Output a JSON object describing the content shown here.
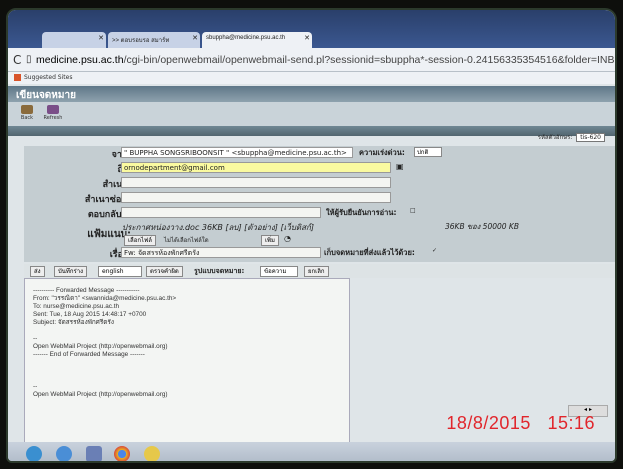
{
  "browser": {
    "tabs": [
      "",
      ">> ตอบรอบรอ สมาร์ท",
      "sbuppha@medicine.psu.ac.th"
    ],
    "url_host": "medicine.psu.ac.th",
    "url_path": "/cgi-bin/openwebmail/openwebmail-send.pl?sessionid=sbuppha*-session-0.24156335354516&folder=INBOX&page=1&longpage=0&sort=date_",
    "bookmark": "Suggested Sites"
  },
  "webmail": {
    "title": "เขียนจดหมาย",
    "toolbar": {
      "back": "Back",
      "refresh": "Refresh"
    },
    "charset_label": "รหัสตัวอักษร:",
    "charset_value": "tis-620",
    "from_label": "จาก:",
    "from_value": "\" BUPPHA SONGSRIBOONSIT \" <sbuppha@medicine.psu.ac.th>",
    "priority_label": "ความเร่งด่วน:",
    "priority_value": "ปกติ",
    "to_label": "ถึง:",
    "to_value": "ornodepartment@gmail.com",
    "cc_label": "สำเนา:",
    "bcc_label": "สำเนาซ่อน:",
    "reply_label": "ตอบกลับที่:",
    "receipt_label": "ให้ผู้รับยืนยันการอ่าน:",
    "attach_label": "แฟ้มแนบ:",
    "attach_file": "ประกาศหน่องวาง.doc  36KB  [ลบ] [ตัวอย่าง] [เว็บดิสก์]",
    "attach_size": "36KB ของ 50000 KB",
    "choose_file": "เลือกไฟล์",
    "no_file": "ไม่ได้เลือกไฟล์ใด",
    "add_btn": "เพิ่ม",
    "subject_label": "เรื่อง:",
    "subject_value": "Fw: จัดสรรห้องพักศรีตรัง",
    "save_sent_label": "เก็บจดหมายที่ส่งแล้วไว้ด้วย:",
    "editor_toolbar": {
      "send": "ส่ง",
      "save_draft": "บันทึกร่าง",
      "lang": "english",
      "spell": "ตรวจคำผิด",
      "format_label": "รูปแบบจดหมาย:",
      "format_value": "ข้อความ",
      "cancel": "ยกเลิก"
    },
    "body_lines": [
      "---------- Forwarded Message -----------",
      "From: \"วรรณิดา\" <swannida@medicine.psu.ac.th>",
      "To: nurse@medicine.psu.ac.th",
      "Sent: Tue, 18 Aug 2015 14:48:17 +0700",
      "Subject: จัดสรรห้องพักศรีตรัง",
      "",
      "--",
      "Open WebMail Project (http://openwebmail.org)",
      "------- End of Forwarded Message -------",
      "",
      "",
      "",
      "--",
      "Open WebMail Project (http://openwebmail.org)"
    ]
  },
  "overlay": {
    "date": "18/8/2015",
    "time": "15:16"
  }
}
